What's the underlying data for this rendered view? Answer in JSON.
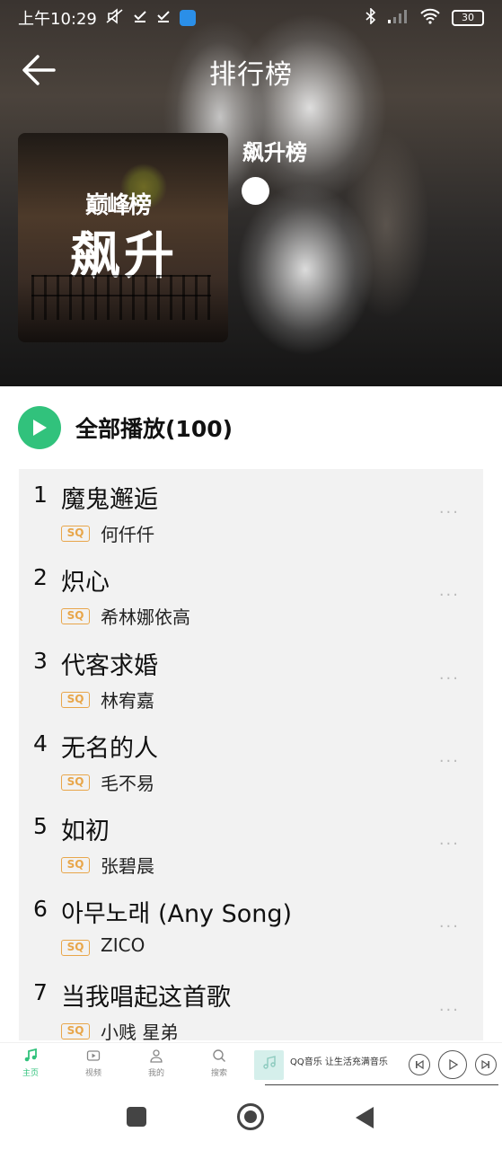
{
  "status_bar": {
    "time": "上午10:29",
    "battery": "30"
  },
  "header": {
    "title": "排行榜"
  },
  "chart": {
    "cover_crown_text": "巅峰榜",
    "cover_title": "飙升",
    "name": "飙升榜"
  },
  "play_all": {
    "label": "全部播放(100)"
  },
  "songs": [
    {
      "rank": "1",
      "title": "魔鬼邂逅",
      "badge": "SQ",
      "artist": "何仟仟"
    },
    {
      "rank": "2",
      "title": "炽心",
      "badge": "SQ",
      "artist": "希林娜依高"
    },
    {
      "rank": "3",
      "title": "代客求婚",
      "badge": "SQ",
      "artist": "林宥嘉"
    },
    {
      "rank": "4",
      "title": "无名的人",
      "badge": "SQ",
      "artist": "毛不易"
    },
    {
      "rank": "5",
      "title": "如初",
      "badge": "SQ",
      "artist": "张碧晨"
    },
    {
      "rank": "6",
      "title": "아무노래 (Any Song)",
      "badge": "SQ",
      "artist": "ZICO"
    },
    {
      "rank": "7",
      "title": "当我唱起这首歌",
      "badge": "SQ",
      "artist": "小贱 星弟"
    }
  ],
  "more_glyph": "···",
  "bottom_nav": {
    "items": [
      {
        "label": "主页",
        "icon": "music-note-icon"
      },
      {
        "label": "视频",
        "icon": "video-icon"
      },
      {
        "label": "我的",
        "icon": "person-icon"
      },
      {
        "label": "搜索",
        "icon": "search-icon"
      }
    ]
  },
  "mini_player": {
    "text": "QQ音乐 让生活充满音乐"
  },
  "colors": {
    "accent": "#31c27c",
    "sq_badge": "#e8a64a",
    "list_bg": "#f2f2f2"
  }
}
